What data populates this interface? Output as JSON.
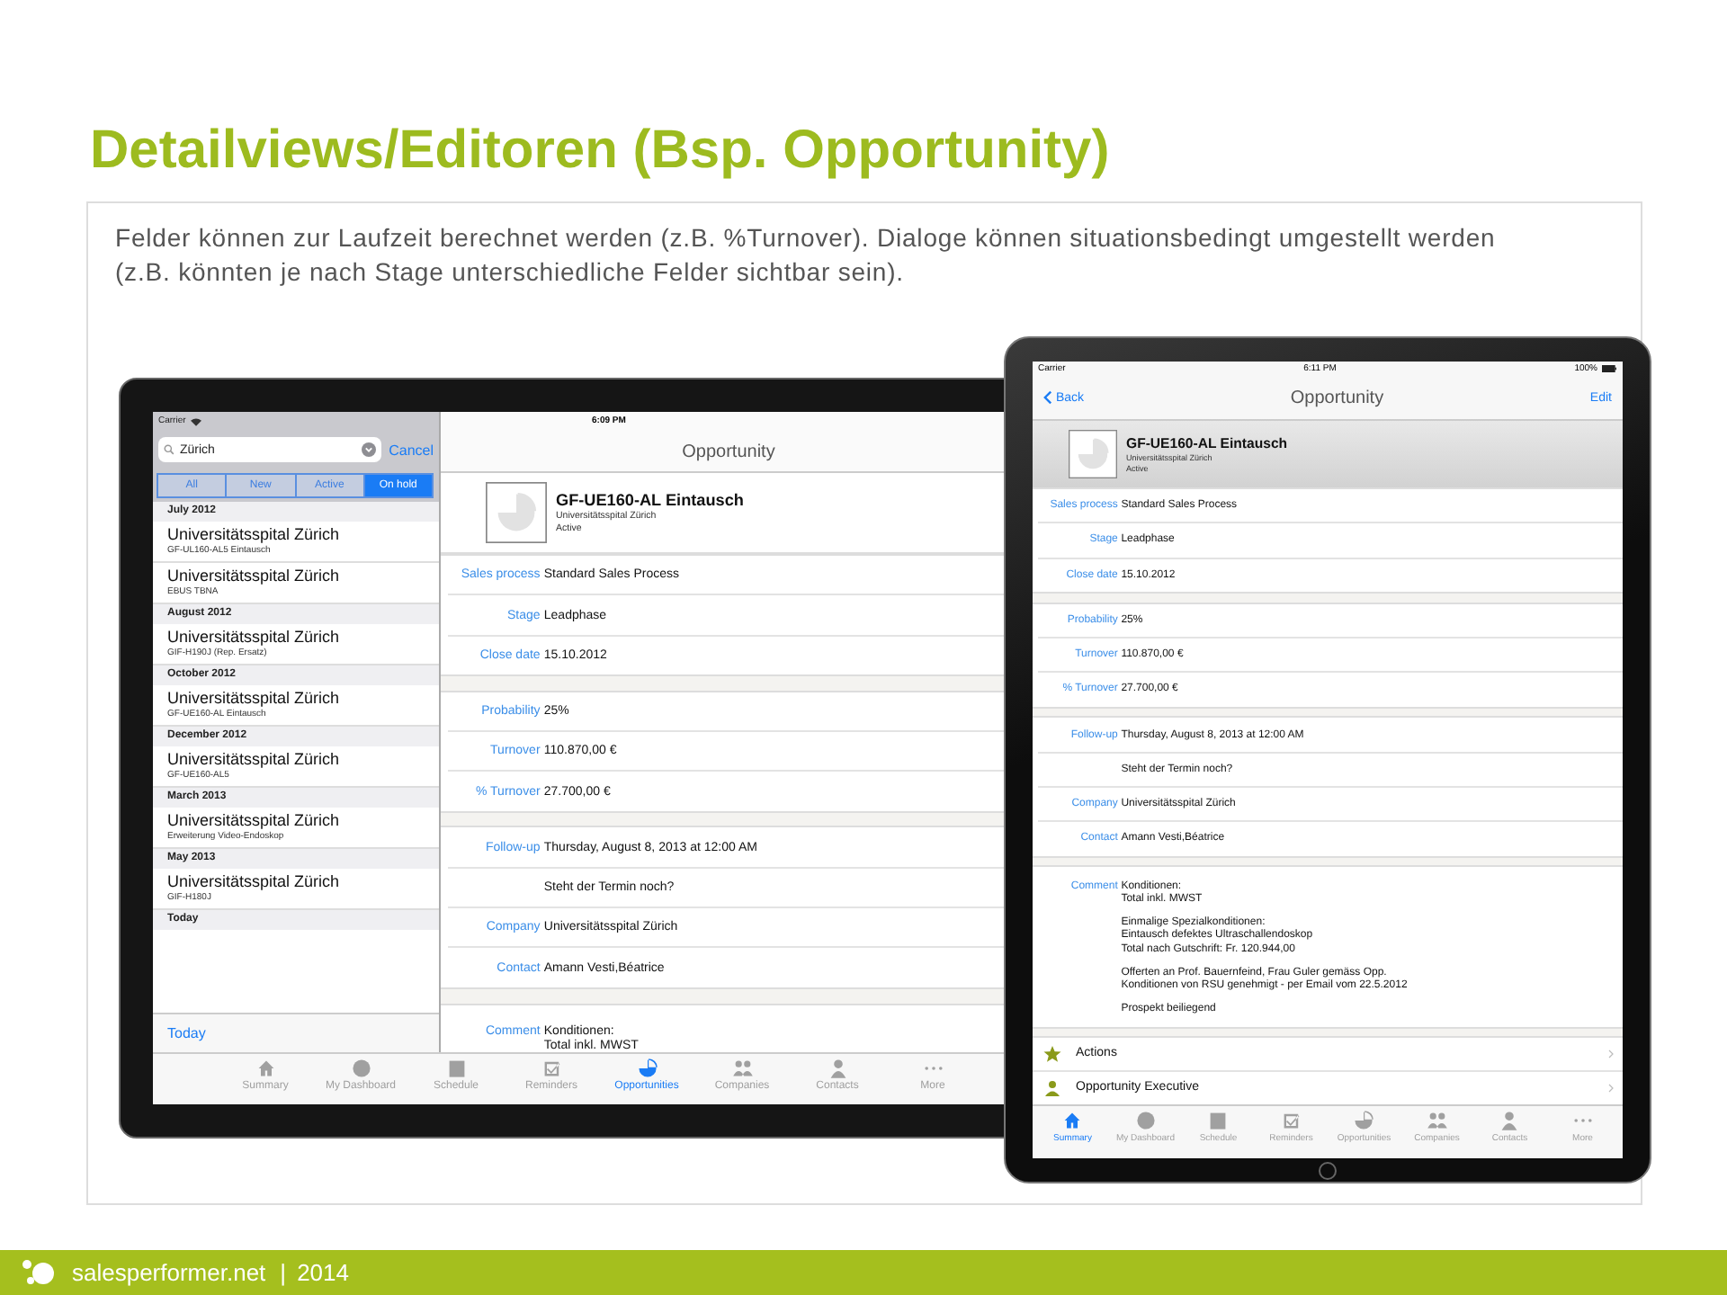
{
  "slide": {
    "title": "Detailviews/Editoren (Bsp. Opportunity)",
    "description": "Felder können zur Laufzeit berechnet werden (z.B. %Turnover). Dialoge können situationsbedingt umgestellt werden (z.B. könnten je nach Stage unterschiedliche Felder sichtbar sein)."
  },
  "left_ipad": {
    "carrier": "Carrier",
    "time": "6:09 PM",
    "search": {
      "value": "Zürich",
      "cancel": "Cancel"
    },
    "segments": [
      {
        "label": "All",
        "selected": false
      },
      {
        "label": "New",
        "selected": false
      },
      {
        "label": "Active",
        "selected": false
      },
      {
        "label": "On hold",
        "selected": true
      }
    ],
    "sections": [
      {
        "title": "July 2012",
        "items": [
          {
            "name": "Universitätsspital Zürich",
            "detail": "GF-UL160-AL5 Eintausch"
          },
          {
            "name": "Universitätsspital Zürich",
            "detail": "EBUS TBNA"
          }
        ]
      },
      {
        "title": "August 2012",
        "items": [
          {
            "name": "Universitätsspital Zürich",
            "detail": "GIF-H190J (Rep. Ersatz)"
          }
        ]
      },
      {
        "title": "October 2012",
        "items": [
          {
            "name": "Universitätsspital Zürich",
            "detail": "GF-UE160-AL Eintausch"
          }
        ]
      },
      {
        "title": "December 2012",
        "items": [
          {
            "name": "Universitätsspital Zürich",
            "detail": "GF-UE160-AL5"
          }
        ]
      },
      {
        "title": "March 2013",
        "items": [
          {
            "name": "Universitätsspital Zürich",
            "detail": "Erweiterung Video-Endoskop"
          }
        ]
      },
      {
        "title": "May 2013",
        "items": [
          {
            "name": "Universitätsspital Zürich",
            "detail": "GIF-H180J"
          }
        ]
      },
      {
        "title": "Today"
      }
    ],
    "toolbar_button": "Today",
    "detail": {
      "title": "Opportunity",
      "header": {
        "name": "GF-UE160-AL Eintausch",
        "company": "Universitätsspital Zürich",
        "status": "Active"
      },
      "groups": [
        [
          {
            "label": "Sales process",
            "value": "Standard Sales Process"
          },
          {
            "label": "Stage",
            "value": "Leadphase"
          },
          {
            "label": "Close date",
            "value": "15.10.2012"
          }
        ],
        [
          {
            "label": "Probability",
            "value": "25%"
          },
          {
            "label": "Turnover",
            "value": "110.870,00 €"
          },
          {
            "label": "% Turnover",
            "value": "27.700,00 €"
          }
        ],
        [
          {
            "label": "Follow-up",
            "value": "Thursday, August 8, 2013 at 12:00 AM"
          },
          {
            "value": "Steht der Termin noch?"
          },
          {
            "label": "Company",
            "value": "Universitätsspital Zürich"
          },
          {
            "label": "Contact",
            "value": "Amann Vesti,Béatrice"
          }
        ]
      ],
      "comment": {
        "label": "Comment",
        "paragraphs": [
          [
            "Konditionen:",
            "Total inkl. MWST"
          ]
        ]
      }
    },
    "tabs": [
      {
        "label": "Summary",
        "selected": false
      },
      {
        "label": "My Dashboard",
        "selected": false
      },
      {
        "label": "Schedule",
        "selected": false
      },
      {
        "label": "Reminders",
        "selected": false
      },
      {
        "label": "Opportunities",
        "selected": true
      },
      {
        "label": "Companies",
        "selected": false
      },
      {
        "label": "Contacts",
        "selected": false
      },
      {
        "label": "More",
        "selected": false
      }
    ]
  },
  "right_ipad": {
    "carrier": "Carrier",
    "time": "6:11 PM",
    "battery": "100%",
    "back": "Back",
    "edit": "Edit",
    "detail": {
      "title": "Opportunity",
      "header": {
        "name": "GF-UE160-AL Eintausch",
        "company": "Universitätsspital Zürich",
        "status": "Active"
      },
      "groups": [
        [
          {
            "label": "Sales process",
            "value": "Standard Sales Process"
          },
          {
            "label": "Stage",
            "value": "Leadphase"
          },
          {
            "label": "Close date",
            "value": "15.10.2012"
          }
        ],
        [
          {
            "label": "Probability",
            "value": "25%"
          },
          {
            "label": "Turnover",
            "value": "110.870,00 €"
          },
          {
            "label": "% Turnover",
            "value": "27.700,00 €"
          }
        ],
        [
          {
            "label": "Follow-up",
            "value": "Thursday, August 8, 2013 at 12:00 AM"
          },
          {
            "value": "Steht der Termin noch?"
          },
          {
            "label": "Company",
            "value": "Universitätsspital Zürich"
          },
          {
            "label": "Contact",
            "value": "Amann Vesti,Béatrice"
          }
        ]
      ],
      "comment": {
        "label": "Comment",
        "paragraphs": [
          [
            "Konditionen:",
            "Total inkl. MWST"
          ],
          [
            "Einmalige Spezialkonditionen:",
            "Eintausch defektes Ultraschallendoskop",
            "Total nach Gutschrift: Fr. 120.944,00"
          ],
          [
            "Offerten an Prof. Bauernfeind, Frau Guler gemäss Opp.",
            "Konditionen von RSU genehmigt - per Email vom 22.5.2012"
          ],
          [
            "Prospekt beiliegend"
          ]
        ]
      }
    },
    "actions": [
      {
        "label": "Actions"
      },
      {
        "label": "Opportunity Executive"
      }
    ],
    "tabs": [
      {
        "label": "Summary",
        "selected": true
      },
      {
        "label": "My Dashboard",
        "selected": false
      },
      {
        "label": "Schedule",
        "selected": false
      },
      {
        "label": "Reminders",
        "selected": false
      },
      {
        "label": "Opportunities",
        "selected": false
      },
      {
        "label": "Companies",
        "selected": false
      },
      {
        "label": "Contacts",
        "selected": false
      },
      {
        "label": "More",
        "selected": false
      }
    ]
  },
  "footer": {
    "site": "salesperformer.net",
    "separator": "|",
    "year": "2014"
  }
}
